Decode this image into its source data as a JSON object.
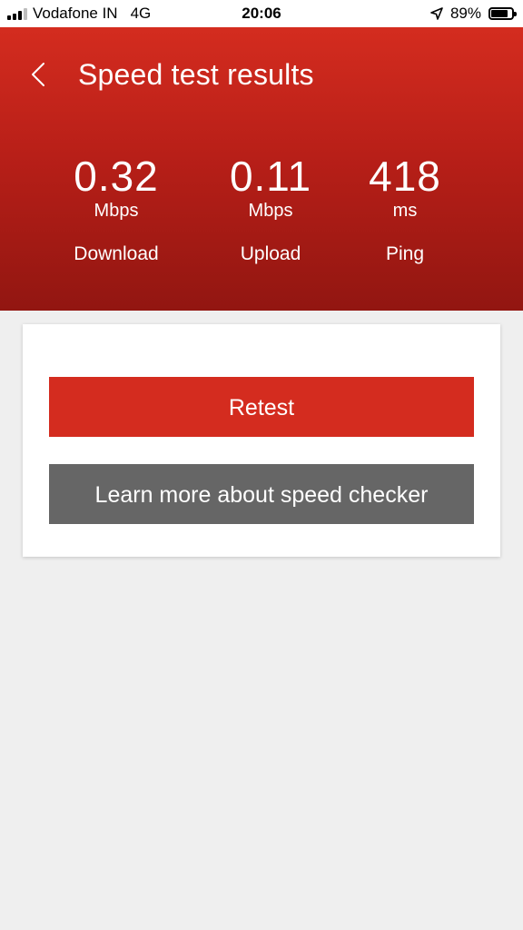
{
  "status_bar": {
    "carrier": "Vodafone IN",
    "network": "4G",
    "time": "20:06",
    "battery_percent_label": "89%",
    "battery_level": 0.89
  },
  "header": {
    "title": "Speed test results",
    "back_icon": "chevron-left-icon"
  },
  "metrics": [
    {
      "value": "0.32",
      "unit": "Mbps",
      "label": "Download"
    },
    {
      "value": "0.11",
      "unit": "Mbps",
      "label": "Upload"
    },
    {
      "value": "418",
      "unit": "ms",
      "label": "Ping"
    }
  ],
  "actions": {
    "retest_label": "Retest",
    "learn_more_label": "Learn more about speed checker"
  },
  "colors": {
    "brand_red": "#d42c1f",
    "secondary_gray": "#666666",
    "background": "#efefef"
  }
}
